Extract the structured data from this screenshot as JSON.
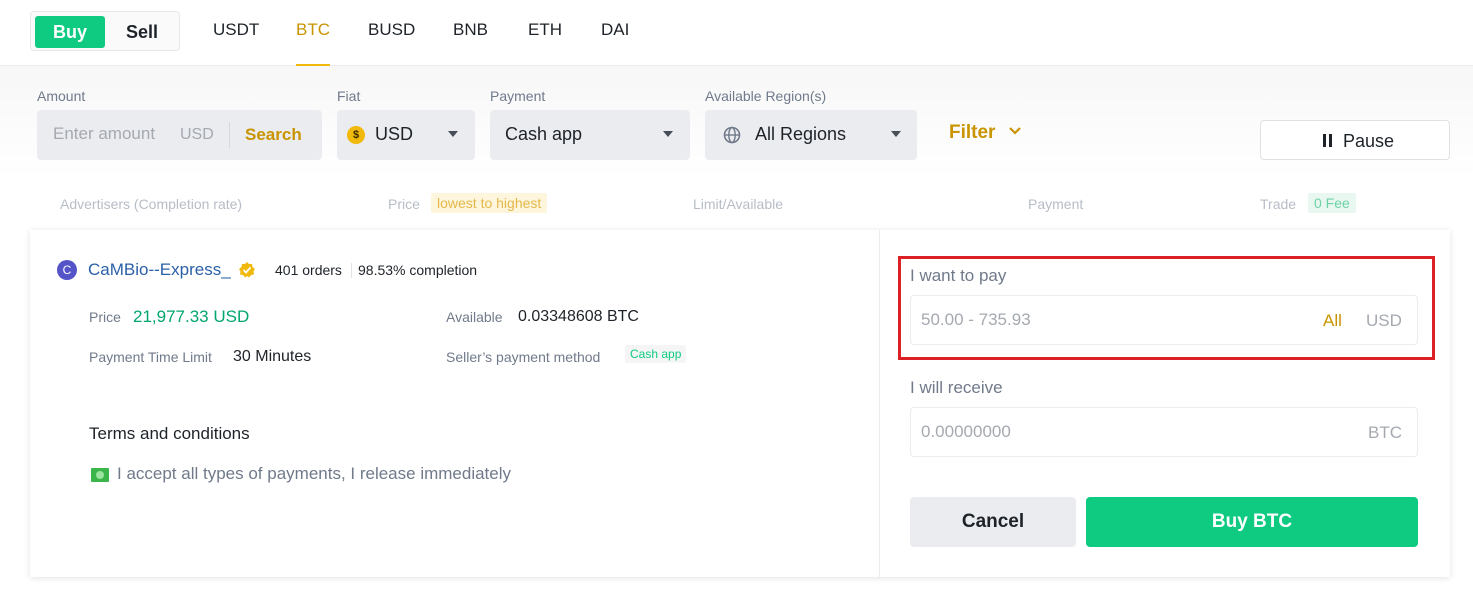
{
  "top_bar": {
    "buy_label": "Buy",
    "sell_label": "Sell",
    "assets": [
      "USDT",
      "BTC",
      "BUSD",
      "BNB",
      "ETH",
      "DAI"
    ],
    "active_asset": "BTC"
  },
  "filters": {
    "amount": {
      "label": "Amount",
      "placeholder": "Enter amount",
      "unit": "USD",
      "search_label": "Search"
    },
    "fiat": {
      "label": "Fiat",
      "value": "USD",
      "icon": "dollar-coin-icon"
    },
    "payment": {
      "label": "Payment",
      "value": "Cash app"
    },
    "region": {
      "label": "Available Region(s)",
      "value": "All Regions",
      "icon": "globe-icon"
    },
    "filter_label": "Filter",
    "pause_label": "Pause"
  },
  "columns": {
    "advertisers": "Advertisers (Completion rate)",
    "price": "Price",
    "price_sort": "lowest to highest",
    "limit": "Limit/Available",
    "payment": "Payment",
    "trade": "Trade",
    "fee": "0 Fee"
  },
  "order": {
    "avatar_letter": "C",
    "advertiser": "CaMBio--Express_",
    "orders": "401 orders",
    "completion": "98.53% completion",
    "price_label": "Price",
    "price_value": "21,977.33 USD",
    "available_label": "Available",
    "available_value": "0.03348608 BTC",
    "time_limit_label": "Payment Time Limit",
    "time_limit_value": "30 Minutes",
    "payment_method_label": "Seller’s payment method",
    "payment_method_value": "Cash app",
    "terms_title": "Terms and conditions",
    "terms_text": "I accept all types of payments, I release immediately"
  },
  "trade_form": {
    "pay_label": "I want to pay",
    "pay_placeholder": "50.00 - 735.93",
    "all_label": "All",
    "pay_unit": "USD",
    "receive_label": "I will receive",
    "receive_placeholder": "0.00000000",
    "receive_unit": "BTC",
    "cancel_label": "Cancel",
    "buy_label": "Buy BTC"
  },
  "colors": {
    "buy_green": "#0ecb81",
    "accent_gold": "#c99400",
    "highlight_red": "#dd1f26",
    "price_green": "#03a66d"
  }
}
